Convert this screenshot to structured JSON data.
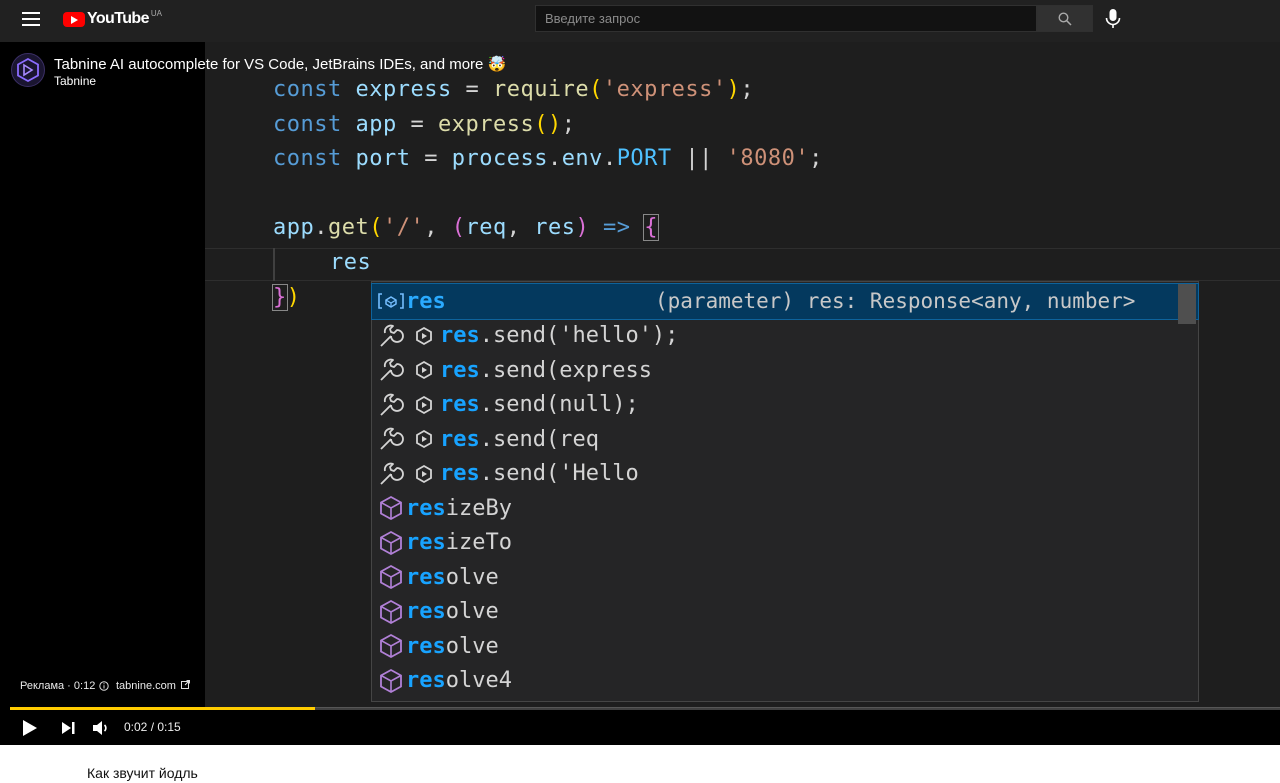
{
  "topbar": {
    "logo_text": "YouTube",
    "logo_region": "UA",
    "search_placeholder": "Введите запрос"
  },
  "video": {
    "title": "Tabnine AI autocomplete for VS Code, JetBrains IDEs, and more 🤯",
    "channel": "Tabnine"
  },
  "code": {
    "line1": {
      "kw": "const",
      "var": "express",
      "op": "=",
      "fn": "require",
      "open": "(",
      "str": "'express'",
      "close": ")",
      "end": ";"
    },
    "line2": {
      "kw": "const",
      "var": "app",
      "op": "=",
      "fn": "express",
      "parens": "()",
      "end": ";"
    },
    "line3": {
      "kw": "const",
      "var": "port",
      "op": "=",
      "obj": "process",
      "dot1": ".",
      "prop1": "env",
      "dot2": ".",
      "prop2": "PORT",
      "or": "||",
      "str": "'8080'",
      "end": ";"
    },
    "line4": {
      "obj": "app",
      "dot": ".",
      "fn": "get",
      "open": "(",
      "str": "'/'",
      "comma": ",",
      "popen": "(",
      "p1": "req",
      "comma2": ",",
      "p2": "res",
      "pclose": ")",
      "arrow": "=>",
      "brace": "{"
    },
    "line5": {
      "text": "res"
    },
    "line6": {
      "brace": "}",
      "paren": ")"
    }
  },
  "suggestions": {
    "selected": {
      "match": "res",
      "rest": "",
      "detail": "(parameter) res: Response<any, number>"
    },
    "items": [
      {
        "match": "res",
        "rest": ".send('hello');"
      },
      {
        "match": "res",
        "rest": ".send(express"
      },
      {
        "match": "res",
        "rest": ".send(null);"
      },
      {
        "match": "res",
        "rest": ".send(req"
      },
      {
        "match": "res",
        "rest": ".send('Hello"
      },
      {
        "match": "res",
        "rest": "izeBy"
      },
      {
        "match": "res",
        "rest": "izeTo"
      },
      {
        "match": "res",
        "rest": "olve"
      },
      {
        "match": "res",
        "rest": "olve"
      },
      {
        "match": "res",
        "rest": "olve"
      },
      {
        "match": "res",
        "rest": "olve4"
      }
    ]
  },
  "player": {
    "ad_label": "Реклама · 0:12",
    "ad_link": "tabnine.com",
    "time": "0:02 / 0:15",
    "progress_fraction": 0.24,
    "progress_color": "#ffcc00"
  },
  "below": {
    "next_title": "Как звучит йодль"
  }
}
